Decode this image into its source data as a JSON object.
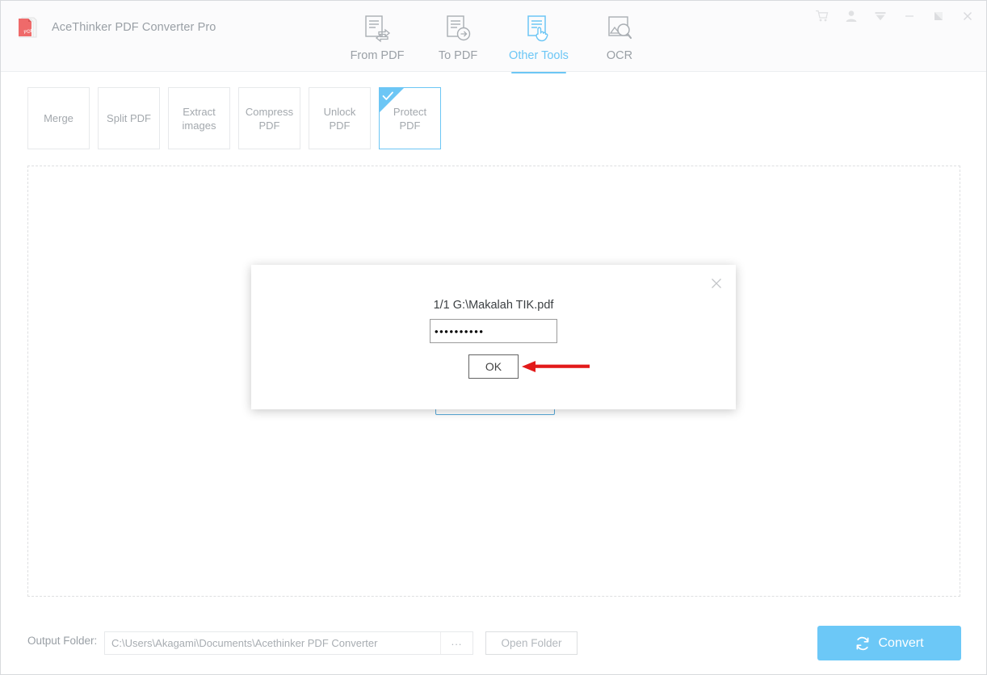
{
  "app": {
    "title": "AceThinker PDF Converter Pro",
    "logo_icon": "pdf-stack-icon"
  },
  "titlebar": {
    "window_buttons": [
      {
        "name": "cart-icon",
        "label": "Cart"
      },
      {
        "name": "account-icon",
        "label": "Account"
      },
      {
        "name": "download-icon",
        "label": "Downloads"
      },
      {
        "name": "minimize-icon",
        "label": "Minimize"
      },
      {
        "name": "restore-icon",
        "label": "Restore"
      },
      {
        "name": "close-icon",
        "label": "Close"
      }
    ]
  },
  "tabs": [
    {
      "label": "From PDF",
      "icon": "from-pdf-icon",
      "active": false
    },
    {
      "label": "To PDF",
      "icon": "to-pdf-icon",
      "active": false
    },
    {
      "label": "Other Tools",
      "icon": "other-tools-icon",
      "active": true
    },
    {
      "label": "OCR",
      "icon": "ocr-icon",
      "active": false
    }
  ],
  "tools": [
    {
      "label": "Merge",
      "selected": false
    },
    {
      "label": "Split PDF",
      "selected": false
    },
    {
      "label": "Extract images",
      "selected": false
    },
    {
      "label": "Compress PDF",
      "selected": false
    },
    {
      "label": "Unlock PDF",
      "selected": false
    },
    {
      "label": "Protect PDF",
      "selected": true
    }
  ],
  "dropzone": {
    "hidden_button_label": ""
  },
  "footer": {
    "output_folder_label": "Output Folder:",
    "output_folder_path": "C:\\Users\\Akagami\\Documents\\Acethinker PDF Converter",
    "browse_label": "...",
    "open_folder_label": "Open Folder",
    "convert_label": "Convert",
    "convert_icon": "refresh-icon"
  },
  "modal": {
    "file_info": "1/1  G:\\Makalah TIK.pdf",
    "password_value": "••••••••••",
    "password_placeholder": "",
    "ok_label": "OK",
    "close_icon": "close-icon",
    "annotation_icon": "red-left-arrow"
  },
  "colors": {
    "accent": "#6cc6f5",
    "convert_bg": "#6cc8f7",
    "text_muted": "#9aa0a6",
    "annotation_red": "#e21a1a"
  }
}
